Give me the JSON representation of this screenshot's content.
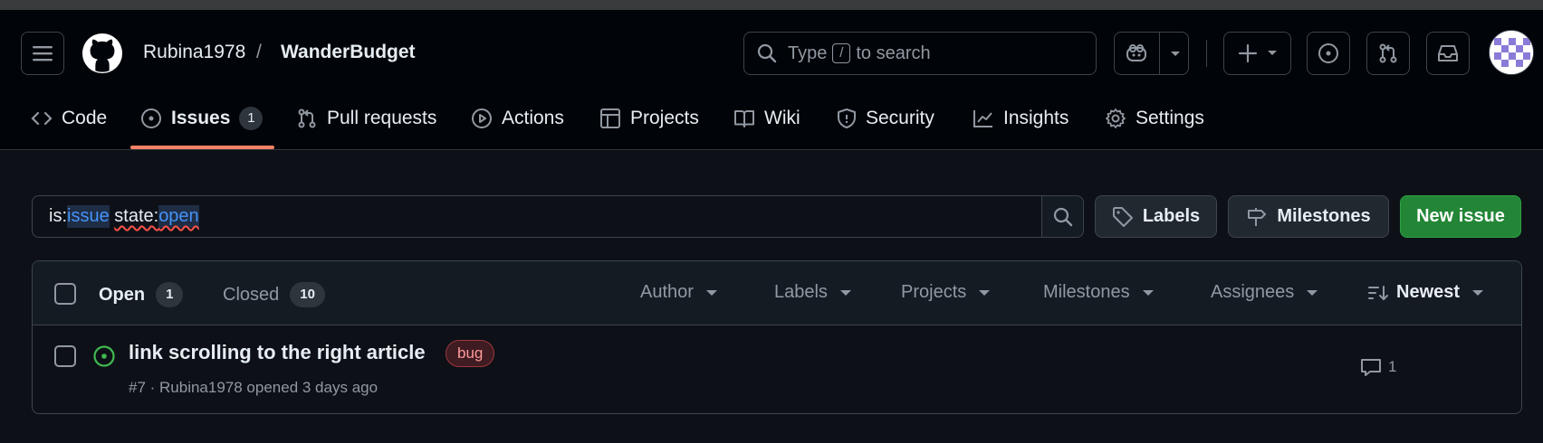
{
  "header": {
    "owner": "Rubina1978",
    "separator": "/",
    "repo": "WanderBudget",
    "search_prefix": "Type",
    "search_key": "/",
    "search_suffix": "to search"
  },
  "tabs": [
    {
      "label": "Code",
      "icon": "code-icon"
    },
    {
      "label": "Issues",
      "icon": "issue-opened-icon",
      "count": "1",
      "active": true
    },
    {
      "label": "Pull requests",
      "icon": "git-pull-request-icon"
    },
    {
      "label": "Actions",
      "icon": "play-icon"
    },
    {
      "label": "Projects",
      "icon": "table-icon"
    },
    {
      "label": "Wiki",
      "icon": "book-icon"
    },
    {
      "label": "Security",
      "icon": "shield-icon"
    },
    {
      "label": "Insights",
      "icon": "graph-icon"
    },
    {
      "label": "Settings",
      "icon": "gear-icon"
    }
  ],
  "filter": {
    "prefix1": "is:",
    "token1": "issue",
    "prefix2": "state:",
    "token2": "open"
  },
  "buttons": {
    "labels": "Labels",
    "milestones": "Milestones",
    "new_issue": "New issue"
  },
  "list": {
    "open_label": "Open",
    "open_count": "1",
    "closed_label": "Closed",
    "closed_count": "10",
    "filters": [
      "Author",
      "Labels",
      "Projects",
      "Milestones",
      "Assignees"
    ],
    "sort": "Newest"
  },
  "issues": [
    {
      "title": "link scrolling to the right article",
      "label": "bug",
      "meta": "#7 · Rubina1978 opened 3 days ago",
      "comments": "1"
    }
  ],
  "colors": {
    "accent_underline": "#f78166",
    "new_issue_green": "#238636",
    "open_icon_green": "#3fb950",
    "bug_label": "#ff9a9a"
  }
}
